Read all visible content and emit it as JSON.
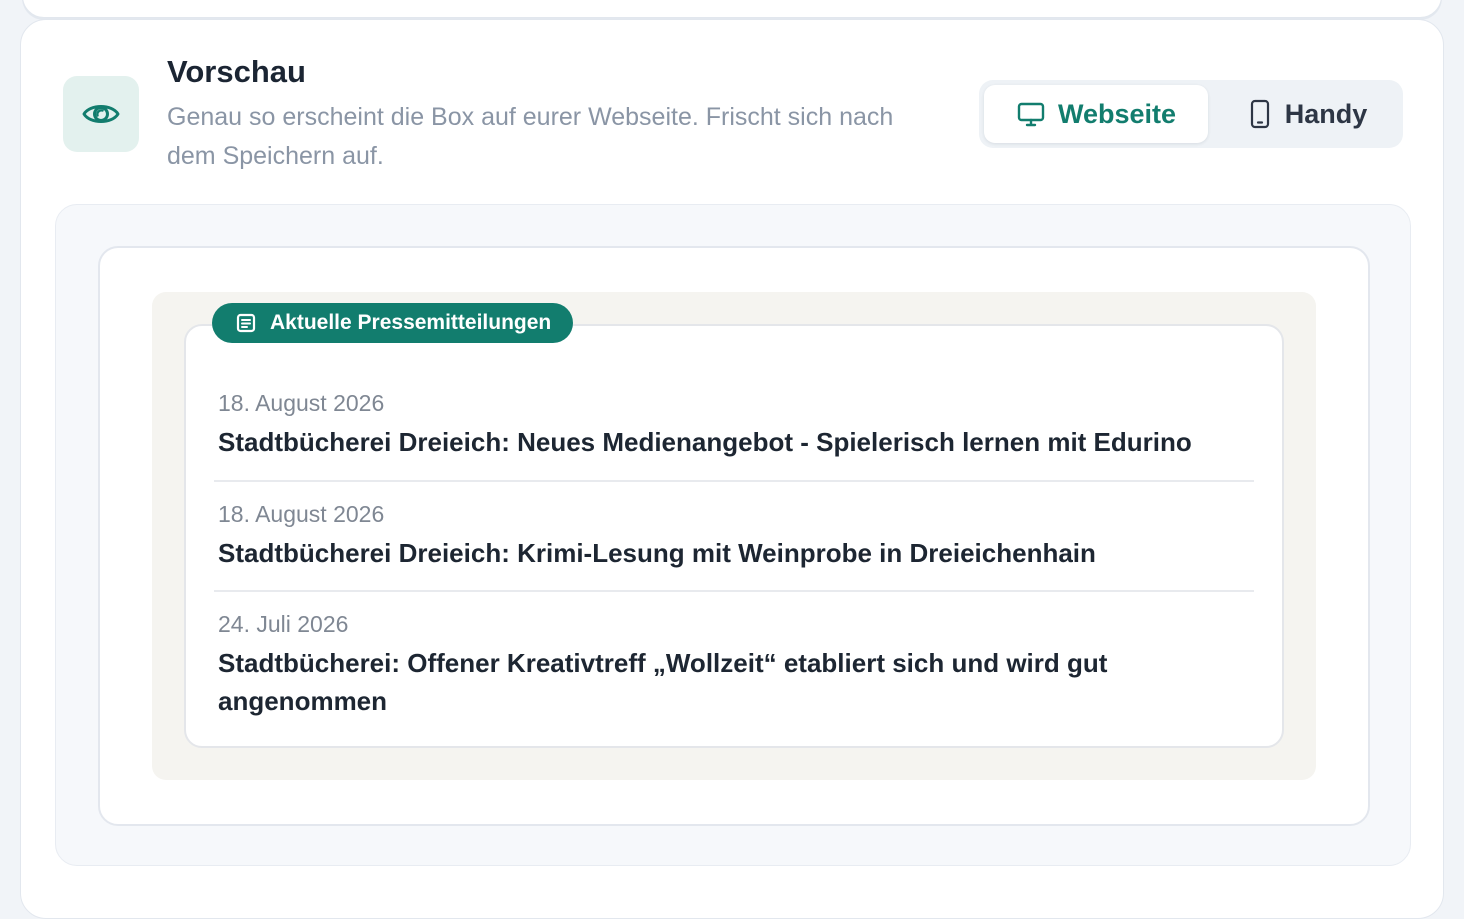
{
  "preview": {
    "title": "Vorschau",
    "subtitle": "Genau so erscheint die Box auf eurer Webseite. Frischt sich nach dem Speichern auf.",
    "icon": "eye-icon",
    "toggle": {
      "website_label": "Webseite",
      "mobile_label": "Handy",
      "selected": "Webseite"
    }
  },
  "widget": {
    "heading": "Aktuelle Pressemitteilungen",
    "heading_icon": "newspaper-icon",
    "items": [
      {
        "date": "18. August 2026",
        "title": "Stadtbücherei Dreieich: Neues Medienangebot - Spielerisch lernen mit Edurino"
      },
      {
        "date": "18. August 2026",
        "title": "Stadtbücherei Dreieich: Krimi-Lesung mit Weinprobe in Dreieichenhain"
      },
      {
        "date": "24. Juli 2026",
        "title": "Stadtbücherei: Offener Kreativtreff „Wollzeit“ etabliert sich und wird gut angenommen"
      }
    ]
  },
  "colors": {
    "accent": "#127d6e",
    "accent_light": "#e3f1ee",
    "text_dark": "#1b2533",
    "text_muted": "#8a95a5",
    "widget_background": "#f5f4f0"
  }
}
